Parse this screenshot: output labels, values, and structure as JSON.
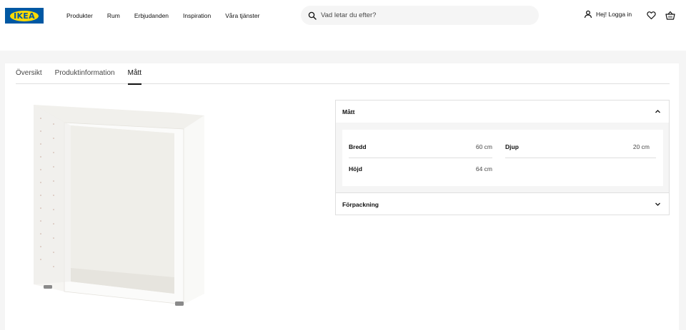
{
  "header": {
    "logo_text": "IKEA",
    "nav": [
      "Produkter",
      "Rum",
      "Erbjudanden",
      "Inspiration",
      "Våra tjänster"
    ],
    "search_placeholder": "Vad letar du efter?",
    "login_label": "Hej! Logga in",
    "icons": [
      "search-icon",
      "user-icon",
      "heart-icon",
      "cart-icon"
    ]
  },
  "tabs": [
    {
      "label": "Översikt",
      "active": false
    },
    {
      "label": "Produktinformation",
      "active": false
    },
    {
      "label": "Mått",
      "active": true
    }
  ],
  "measurements_panel": {
    "title": "Mått",
    "expanded": true,
    "dims": [
      {
        "label": "Bredd",
        "value": "60 cm"
      },
      {
        "label": "Djup",
        "value": "20 cm"
      },
      {
        "label": "Höjd",
        "value": "64 cm"
      }
    ]
  },
  "packaging_panel": {
    "title": "Förpackning",
    "expanded": false
  },
  "colors": {
    "brand_blue": "#0058a3",
    "brand_yellow": "#ffdb00"
  }
}
